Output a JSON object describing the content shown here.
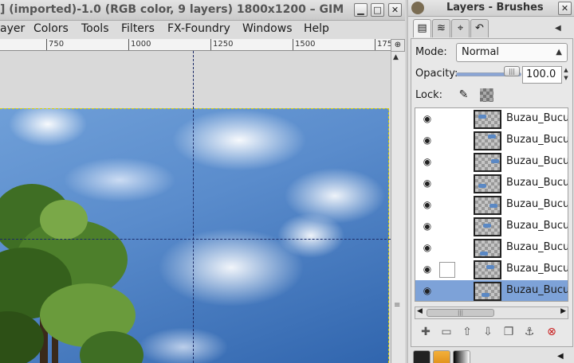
{
  "image_window": {
    "title": "] (imported)-1.0 (RGB color, 9 layers) 1800x1200 – GIM",
    "controls": {
      "minimize": "▁",
      "maximize": "□",
      "close": "✕"
    },
    "menu": [
      "ayer",
      "Colors",
      "Tools",
      "Filters",
      "FX-Foundry",
      "Windows",
      "Help"
    ],
    "ruler_labels": [
      "750",
      "1000",
      "1250",
      "1500",
      "175"
    ]
  },
  "layers_dock": {
    "title": "Layers - Brushes",
    "close": "✕",
    "mode_label": "Mode:",
    "mode_value": "Normal",
    "opacity_label": "Opacity:",
    "opacity_value": "100.0",
    "opacity_level": 1.0,
    "lock_label": "Lock:",
    "layers": [
      {
        "name": "Buzau_Bucuresti",
        "visible": true,
        "selected": false,
        "chain_box": false
      },
      {
        "name": "Buzau_Bucuresti",
        "visible": true,
        "selected": false,
        "chain_box": false
      },
      {
        "name": "Buzau_Bucuresti",
        "visible": true,
        "selected": false,
        "chain_box": false
      },
      {
        "name": "Buzau_Bucuresti",
        "visible": true,
        "selected": false,
        "chain_box": false
      },
      {
        "name": "Buzau_Bucuresti",
        "visible": true,
        "selected": false,
        "chain_box": false
      },
      {
        "name": "Buzau_Bucuresti",
        "visible": true,
        "selected": false,
        "chain_box": false
      },
      {
        "name": "Buzau_Bucuresti",
        "visible": true,
        "selected": false,
        "chain_box": false
      },
      {
        "name": "Buzau_Bucuresti",
        "visible": true,
        "selected": false,
        "chain_box": true
      },
      {
        "name": "Buzau_Bucuresti",
        "visible": true,
        "selected": true,
        "chain_box": false
      }
    ]
  },
  "colors": {
    "selection": "#7da2d8",
    "delete_icon": "#c81e1e",
    "guide": "#1b2a66",
    "layer_boundary": "#d8d000"
  }
}
